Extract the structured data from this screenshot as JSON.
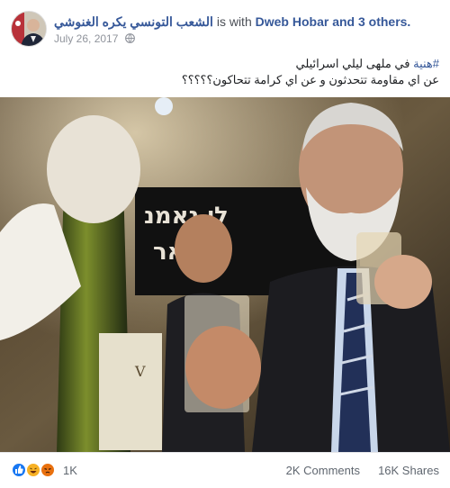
{
  "post": {
    "author": "الشعب التونسي يكره الغنوشي",
    "with_text": "is with",
    "tagged": "Dweb Hobar and 3 others.",
    "date": "July 26, 2017",
    "audience_icon": "globe-icon",
    "text_line1_hashtag": "#هنية",
    "text_line1_rest": " في ملهى ليلي اسرائيلي",
    "text_line2": "عن اي مقاومة تتحدثون و عن اي كرامة تتحاكون؟؟؟؟؟"
  },
  "photo": {
    "sign_line1": "לי נאמנ",
    "sign_line2": "אין אר"
  },
  "footer": {
    "reaction_icons": [
      "like-icon",
      "haha-icon",
      "angry-icon"
    ],
    "reaction_count": "1K",
    "comments": "2K Comments",
    "shares": "16K Shares"
  },
  "colors": {
    "link": "#365899",
    "like": "#1877f2",
    "haha": "#f7b125",
    "angry": "#e9710f"
  }
}
